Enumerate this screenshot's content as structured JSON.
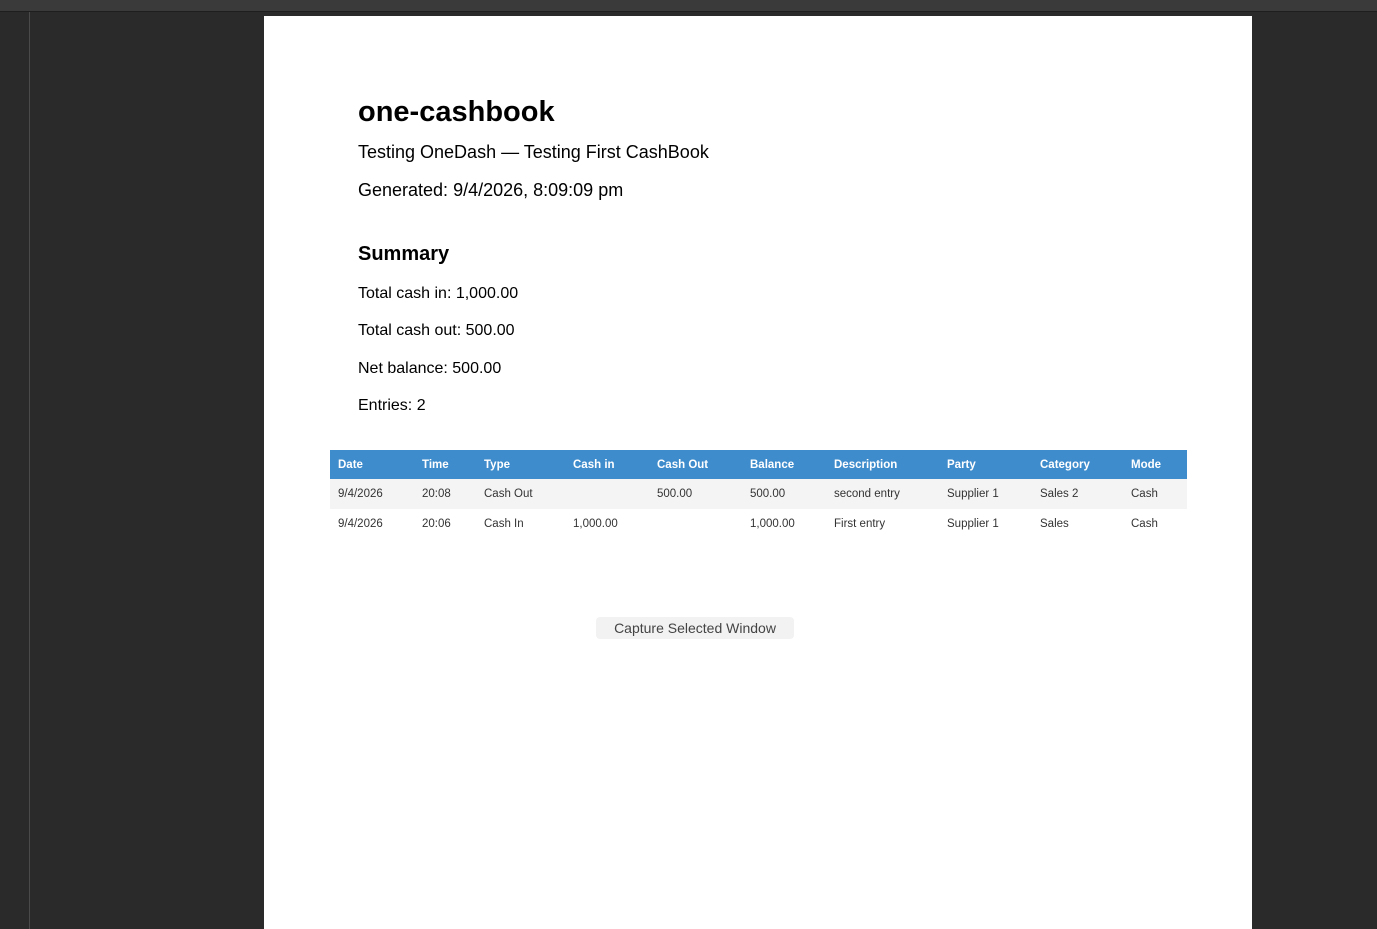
{
  "report": {
    "title": "one-cashbook",
    "subtitle": "Testing OneDash — Testing First CashBook",
    "generated": "Generated: 9/4/2026, 8:09:09 pm"
  },
  "summary": {
    "heading": "Summary",
    "total_cash_in": "Total cash in: 1,000.00",
    "total_cash_out": "Total cash out: 500.00",
    "net_balance": "Net balance: 500.00",
    "entries": "Entries: 2"
  },
  "table": {
    "columns": [
      "Date",
      "Time",
      "Type",
      "Cash in",
      "Cash Out",
      "Balance",
      "Description",
      "Party",
      "Category",
      "Mode"
    ],
    "rows": [
      [
        "9/4/2026",
        "20:08",
        "Cash Out",
        "",
        "500.00",
        "500.00",
        "second entry",
        "Supplier 1",
        "Sales 2",
        "Cash"
      ],
      [
        "9/4/2026",
        "20:06",
        "Cash In",
        "1,000.00",
        "",
        "1,000.00",
        "First entry",
        "Supplier 1",
        "Sales",
        "Cash"
      ]
    ]
  },
  "overlay": {
    "capture_label": "Capture Selected Window"
  },
  "colors": {
    "header_bg": "#3f8ccc",
    "app_bg": "#2a2a2a",
    "page_bg": "#ffffff"
  }
}
